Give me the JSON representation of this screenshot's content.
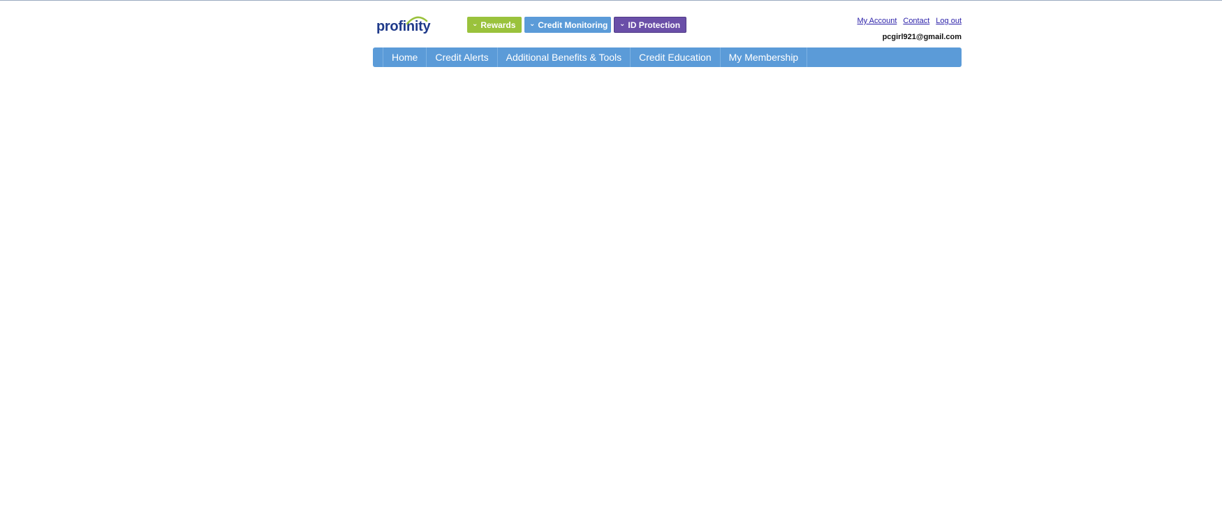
{
  "brand": {
    "logo_text": "profinity",
    "accent_color": "#9ac23c",
    "text_color": "#1f3a8a"
  },
  "product_tabs": [
    {
      "label": "Rewards",
      "color": "#9ac23c",
      "icon": "chevron-down-icon"
    },
    {
      "label": "Credit Monitoring",
      "color": "#5b9bd8",
      "icon": "chevron-down-icon"
    },
    {
      "label": "ID Protection",
      "color": "#6a4fa8",
      "icon": "chevron-down-icon"
    }
  ],
  "account": {
    "links": {
      "my_account": "My Account",
      "contact": "Contact",
      "logout": "Log out"
    },
    "email": "pcgirl921@gmail.com"
  },
  "nav": {
    "color": "#5b9bd8",
    "items": [
      {
        "label": "Home"
      },
      {
        "label": "Credit Alerts"
      },
      {
        "label": "Additional Benefits & Tools"
      },
      {
        "label": "Credit Education"
      },
      {
        "label": "My Membership"
      }
    ]
  }
}
